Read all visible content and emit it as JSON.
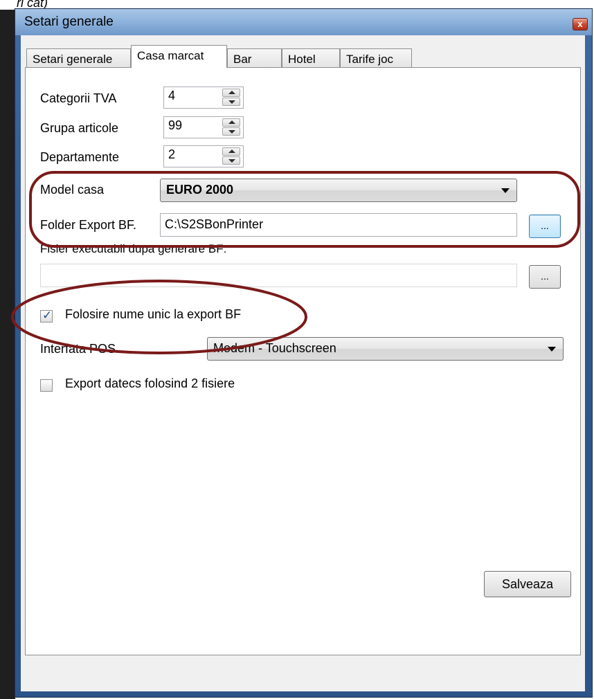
{
  "background": {
    "text": "ri cat)"
  },
  "window": {
    "title": "Setari generale",
    "close_label": "x"
  },
  "tabs": [
    {
      "label": "Setari generale",
      "active": false
    },
    {
      "label": "Casa marcat",
      "active": true
    },
    {
      "label": "Bar",
      "active": false
    },
    {
      "label": "Hotel",
      "active": false
    },
    {
      "label": "Tarife joc",
      "active": false
    }
  ],
  "casa_marcat": {
    "categorii_tva": {
      "label": "Categorii TVA",
      "value": "4"
    },
    "grupa_articole": {
      "label": "Grupa articole",
      "value": "99"
    },
    "departamente": {
      "label": "Departamente",
      "value": "2"
    },
    "model_casa": {
      "label": "Model casa",
      "value": "EURO 2000"
    },
    "folder_export": {
      "label": "Folder Export BF.",
      "value": "C:\\S2SBonPrinter",
      "browse_label": "..."
    },
    "fisier_executabil": {
      "label": "Fisier executabil dupa generare BF:",
      "value": "",
      "browse_label": "..."
    },
    "folosire_nume_unic": {
      "label": "Folosire nume unic la export BF",
      "checked": true
    },
    "interfata_pos": {
      "label": "Interfata POS",
      "value": "Modem - Touchscreen"
    },
    "export_datecs": {
      "label": "Export datecs folosind 2 fisiere",
      "checked": false
    }
  },
  "footer": {
    "save_label": "Salveaza"
  },
  "colors": {
    "annotation": "#7a1a1a",
    "title_bar": "#8fb4dd",
    "frame": "#30588d"
  }
}
